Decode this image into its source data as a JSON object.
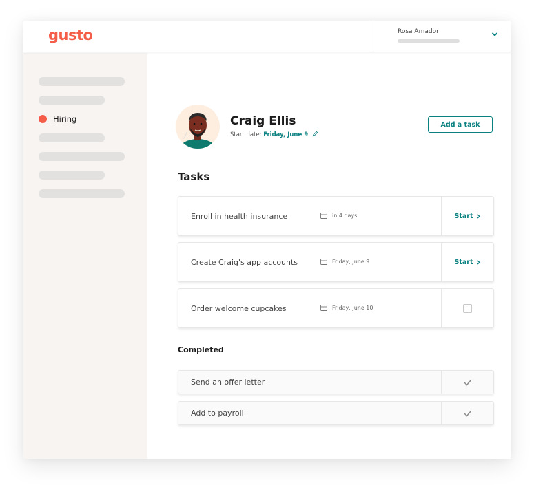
{
  "app": {
    "brand": "gusto",
    "brand_color": "#f45d48",
    "accent_color": "#0a8080"
  },
  "header": {
    "account_name": "Rosa Amador",
    "account_menu_icon": "chevron-down-icon"
  },
  "sidebar": {
    "active_item": {
      "label": "Hiring",
      "icon": "status-dot"
    }
  },
  "employee": {
    "name": "Craig Ellis",
    "start_date_label": "Start date:",
    "start_date": "Friday, June 9",
    "edit_icon": "pencil-icon"
  },
  "actions": {
    "add_task_label": "Add a task"
  },
  "tasks": {
    "title": "Tasks",
    "items": [
      {
        "label": "Enroll in health insurance",
        "due": "in 4 days",
        "action": "Start"
      },
      {
        "label": "Create Craig's app accounts",
        "due": "Friday, June 9",
        "action": "Start"
      },
      {
        "label": "Order welcome cupcakes",
        "due": "Friday, June 10",
        "action": "checkbox",
        "checked": false
      }
    ]
  },
  "completed": {
    "title": "Completed",
    "items": [
      {
        "label": "Send an offer letter",
        "status": "checkmark"
      },
      {
        "label": "Add to payroll",
        "status": "checkmark"
      }
    ]
  }
}
